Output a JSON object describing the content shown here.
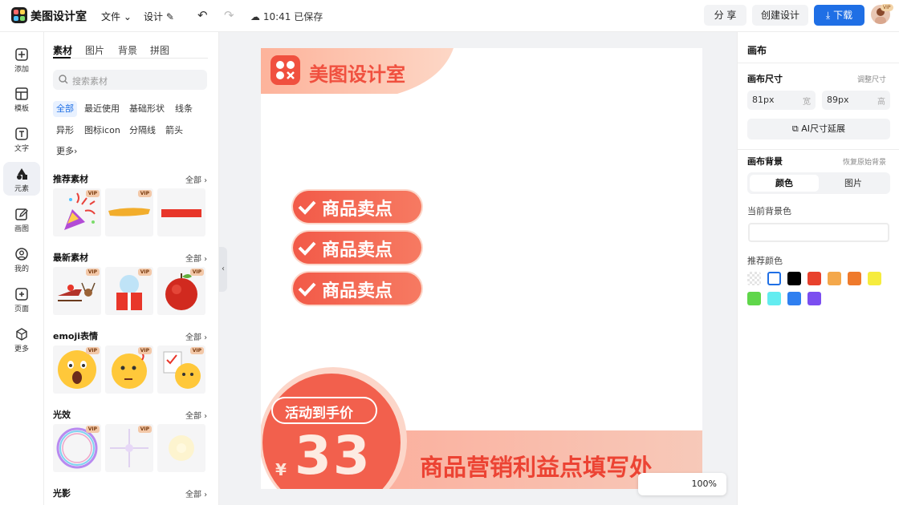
{
  "app": {
    "name": "美图设计室"
  },
  "topbar": {
    "file_menu": "文件",
    "design_menu": "设计",
    "saved_status": "10:41 已保存",
    "share_label": "分 享",
    "create_label": "创建设计",
    "download_label": "下载",
    "avatar_badge": "VIP"
  },
  "leftnav": {
    "items": [
      {
        "label": "添加",
        "icon": "plus-square-icon"
      },
      {
        "label": "模板",
        "icon": "template-icon"
      },
      {
        "label": "文字",
        "icon": "text-icon"
      },
      {
        "label": "元素",
        "icon": "shapes-icon",
        "active": true
      },
      {
        "label": "画图",
        "icon": "pencil-icon"
      },
      {
        "label": "我的",
        "icon": "user-icon"
      },
      {
        "label": "页面",
        "icon": "page-add-icon"
      },
      {
        "label": "更多",
        "icon": "cube-icon"
      }
    ]
  },
  "panel": {
    "tabs": [
      "素材",
      "图片",
      "背景",
      "拼图"
    ],
    "search_placeholder": "搜索素材",
    "chips": [
      "全部",
      "最近使用",
      "基础形状",
      "线条",
      "异形",
      "图标icon",
      "分隔线",
      "箭头",
      "更多"
    ],
    "sections": [
      {
        "title": "推荐素材",
        "all": "全部"
      },
      {
        "title": "最新素材",
        "all": "全部"
      },
      {
        "title": "emoji表情",
        "all": "全部"
      },
      {
        "title": "光效",
        "all": "全部"
      },
      {
        "title": "光影",
        "all": "全部"
      }
    ],
    "vip_label": "VIP"
  },
  "canvas": {
    "brand_text": "美图设计室",
    "selling_points": [
      "商品卖点",
      "商品卖点",
      "商品卖点"
    ],
    "promo_label": "活动到手价",
    "currency": "¥",
    "price": "33",
    "banner_text": "商品营销利益点填写处",
    "zoom": "100%"
  },
  "right": {
    "title": "画布",
    "size_title": "画布尺寸",
    "adjust_link": "调整尺寸",
    "width_value": "81px",
    "width_unit": "宽",
    "height_value": "89px",
    "height_unit": "高",
    "ai_extend": "AI尺寸延展",
    "bg_title": "画布背景",
    "restore_link": "恢复原始背景",
    "seg_color": "颜色",
    "seg_image": "图片",
    "current_bg": "当前背景色",
    "recommended": "推荐颜色",
    "swatches": [
      "transparent",
      "#ffffff",
      "#000000",
      "#e8412c",
      "#f4a84b",
      "#ef7a2c",
      "#f6ec3e",
      "#5fd64a",
      "#63ecf0",
      "#2f7ff0",
      "#7b4ef0"
    ]
  },
  "colors": {
    "accent": "#1f6fe5",
    "brand_red": "#f06a58"
  }
}
